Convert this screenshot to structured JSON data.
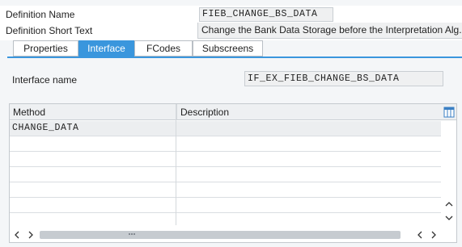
{
  "header": {
    "definition_name_label": "Definition Name",
    "definition_name_value": "FIEB_CHANGE_BS_DATA",
    "short_text_label": "Definition Short Text",
    "short_text_value": "Change the Bank Data Storage before the Interpretation Alg."
  },
  "tabs": [
    {
      "label": "Properties",
      "active": false
    },
    {
      "label": "Interface",
      "active": true
    },
    {
      "label": "FCodes",
      "active": false
    },
    {
      "label": "Subscreens",
      "active": false
    }
  ],
  "interface": {
    "name_label": "Interface name",
    "name_value": "IF_EX_FIEB_CHANGE_BS_DATA"
  },
  "methods_table": {
    "columns": [
      "Method",
      "Description"
    ],
    "rows": [
      {
        "method": "CHANGE_DATA",
        "description": ""
      }
    ]
  },
  "icons": {
    "table_settings": "column-settings-icon",
    "scroll_up": "chevron-up-icon",
    "scroll_down": "chevron-down-icon",
    "scroll_left": "chevron-left-icon",
    "scroll_right": "chevron-right-icon"
  },
  "colors": {
    "accent": "#3a96dd",
    "background": "#f4f6f8",
    "field_bg": "#eff0f1"
  }
}
